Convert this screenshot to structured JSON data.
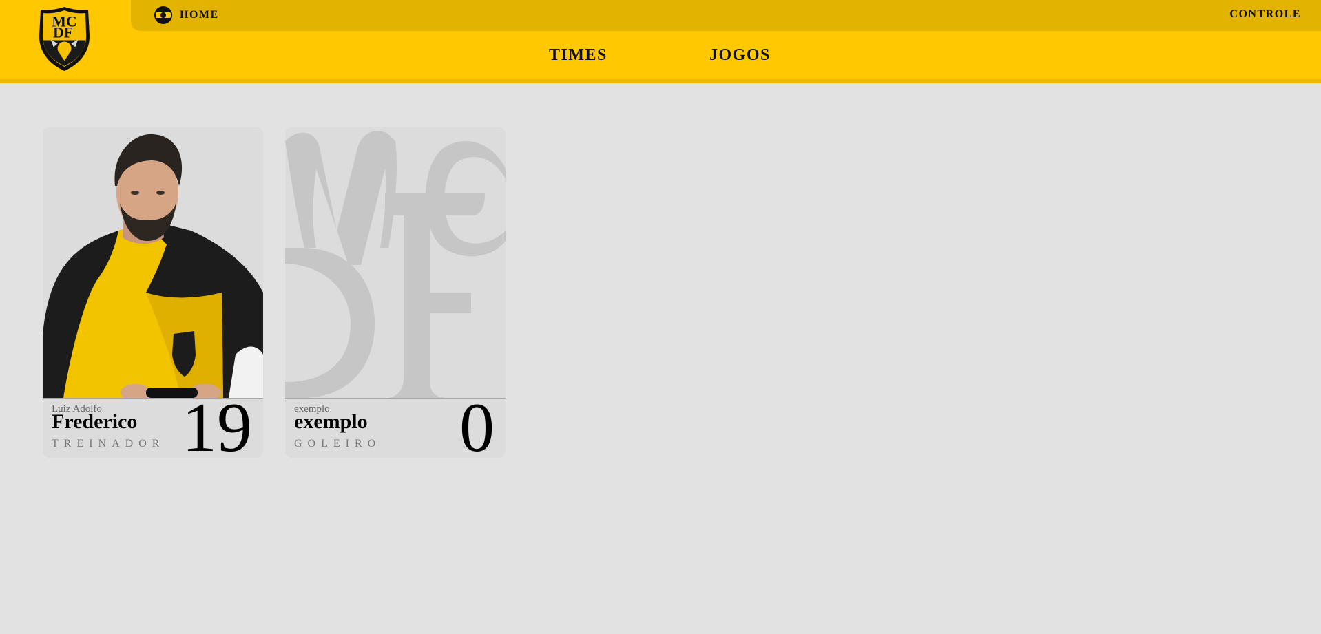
{
  "header": {
    "logo_text": "MCDF",
    "home_label": "HOME",
    "controle_label": "CONTROLE",
    "nav": [
      "TIMES",
      "JOGOS"
    ]
  },
  "colors": {
    "header_yellow": "#ffc800",
    "topbar_yellow": "#e2b300",
    "page_background": "#e2e2e2",
    "card_background": "#dcdcdc"
  },
  "players": [
    {
      "first_name": "Luiz Adolfo",
      "last_name": "Frederico",
      "position": "TREINADOR",
      "number": "19",
      "photo": "player-photo"
    },
    {
      "first_name": "exemplo",
      "last_name": "exemplo",
      "position": "GOLEIRO",
      "number": "0",
      "photo": "monogram-placeholder"
    }
  ]
}
